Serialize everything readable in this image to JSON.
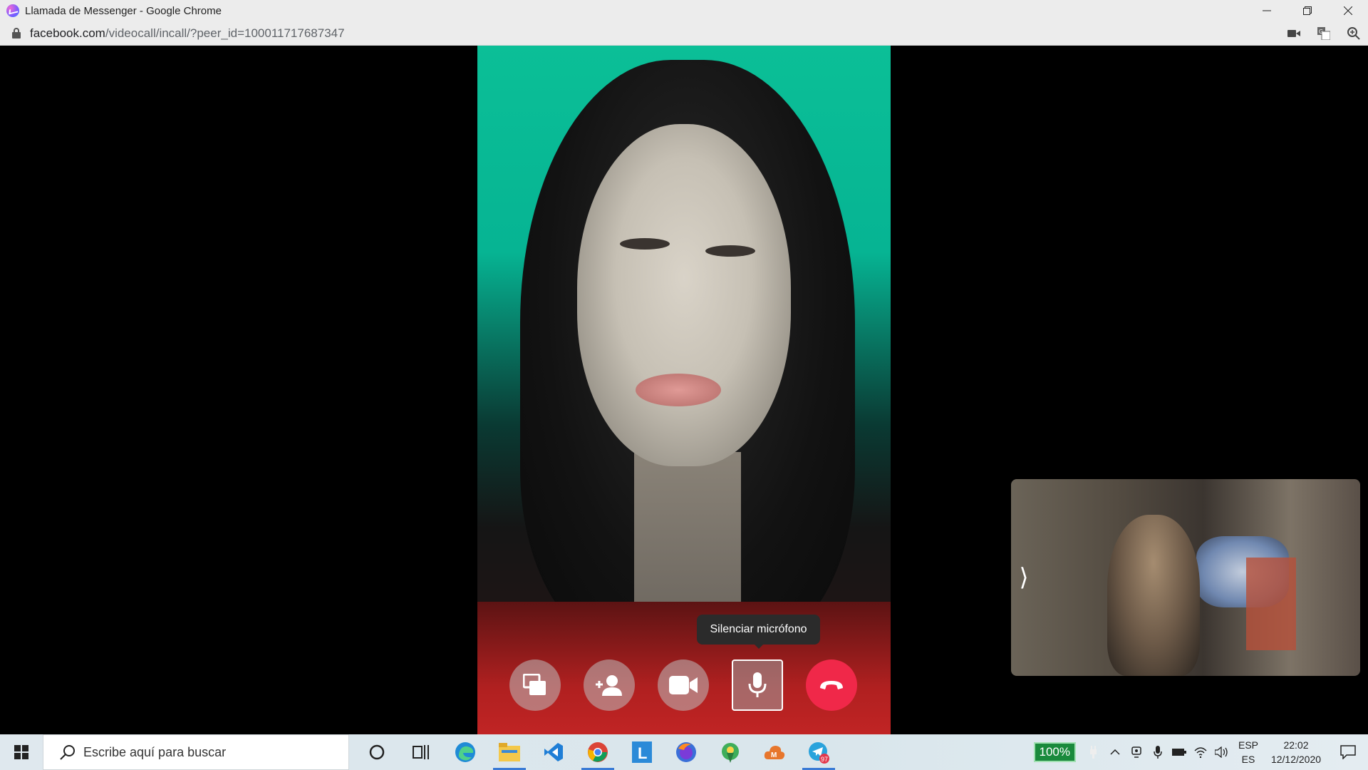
{
  "window": {
    "title": "Llamada de Messenger - Google Chrome",
    "controls": [
      "minimize",
      "restore",
      "close"
    ]
  },
  "address_bar": {
    "host": "facebook.com",
    "path": "/videocall/incall/?peer_id=100011717687347",
    "right_icons": [
      "camera-icon",
      "translate-icon",
      "zoom-icon"
    ]
  },
  "call": {
    "tooltip": "Silenciar micrófono",
    "controls": [
      {
        "name": "share-screen",
        "icon": "share-screen-icon"
      },
      {
        "name": "add-person",
        "icon": "add-person-icon"
      },
      {
        "name": "camera",
        "icon": "camera-icon"
      },
      {
        "name": "microphone",
        "icon": "microphone-icon"
      },
      {
        "name": "hang-up",
        "icon": "hang-up-icon"
      }
    ],
    "self_view_toggle": "⟩"
  },
  "taskbar": {
    "search_placeholder": "Escribe aquí para buscar",
    "apps": [
      "cortana",
      "task-view",
      "edge",
      "file-explorer",
      "vscode",
      "chrome",
      "launcher-l",
      "firefox",
      "maps",
      "mega",
      "telegram"
    ],
    "telegram_badge": "97",
    "battery_percent": "100%",
    "language_top": "ESP",
    "language_bottom": "ES",
    "time": "22:02",
    "date": "12/12/2020"
  },
  "colors": {
    "hangup": "#f02849",
    "taskbar_active": "#3a7bd5"
  }
}
